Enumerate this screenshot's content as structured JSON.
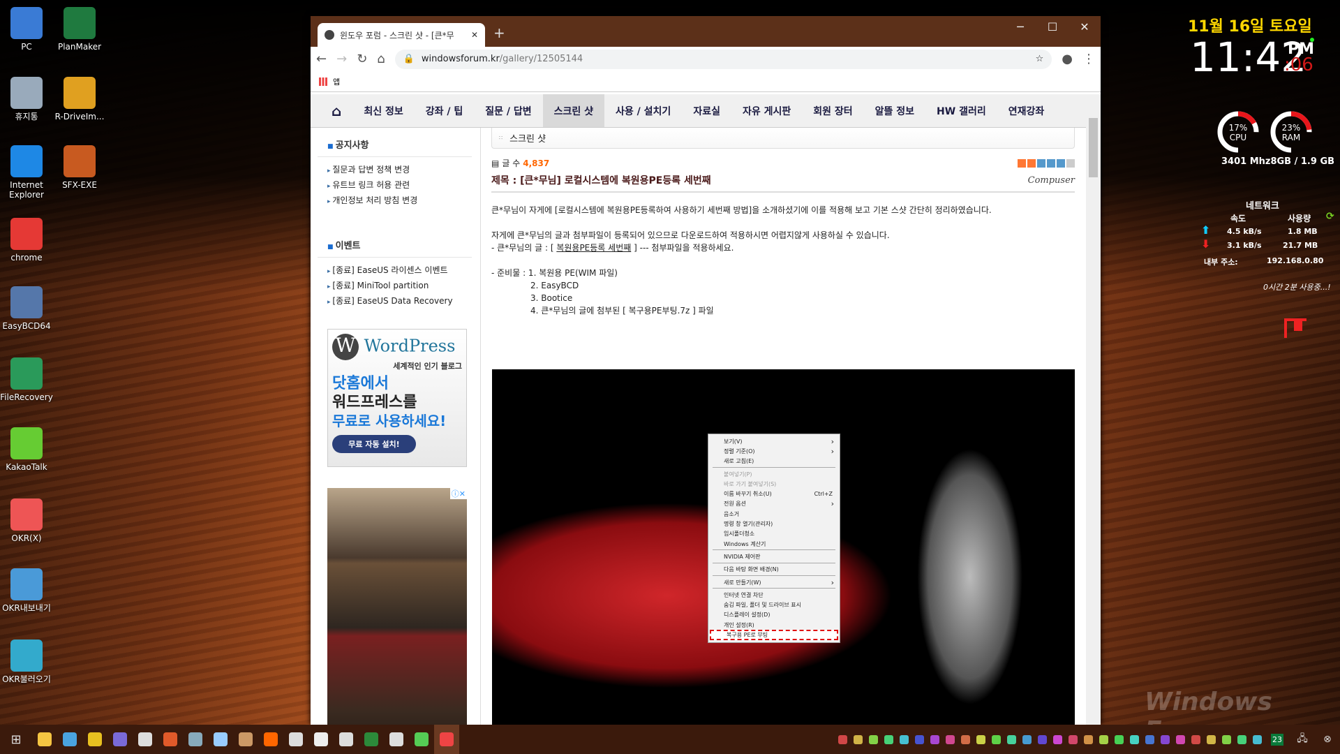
{
  "desktop": {
    "icons": [
      "PC",
      "PlanMaker",
      "휴지통",
      "R-DriveIm...",
      "Internet Explorer",
      "SFX-EXE",
      "chrome",
      "EasyBCD64",
      "FileRecovery",
      "KakaoTalk",
      "OKR(X)",
      "OKR내보내기",
      "OKR불러오기"
    ]
  },
  "browser": {
    "tab_title": "윈도우 포럼 - 스크린 샷 - [큰*무",
    "url_host": "windowsforum.kr",
    "url_path": "/gallery/12505144",
    "bookmark_apps": "앱"
  },
  "site": {
    "nav": [
      "최신 정보",
      "강좌 / 팁",
      "질문 / 답변",
      "스크린 샷",
      "사용 / 설치기",
      "자료실",
      "자유 게시판",
      "회원 장터",
      "알뜰 정보",
      "HW 갤러리",
      "연재강좌"
    ],
    "sidebar": {
      "notice_title": "공지사항",
      "notices": [
        "질문과 답변 정책 변경",
        "유트브 링크 허용 관련",
        "개인정보 처리 방침 변경"
      ],
      "event_title": "이벤트",
      "events": [
        "[종료] EaseUS 라이센스 이벤트",
        "[종료] MiniTool partition",
        "[종료] EaseUS Data Recovery"
      ],
      "ad": {
        "brand": "WordPress",
        "tagline": "세계적인 인기 블로그",
        "line1": "닷홈에서",
        "line2": "워드프레스를",
        "line3": "무료로 사용하세요!",
        "button": "무료 자동 설치!"
      }
    },
    "breadcrumb": "스크린 샷",
    "count_label": "글 수",
    "count": "4,837",
    "title": "제목 : [큰*무님] 로컬시스템에 복원용PE등록 세번째",
    "author": "Compuser",
    "body": {
      "p1": "큰*무님이 자게에 [로컬시스템에 복원용PE등록하여 사용하기 세번째 방법]을 소개하셨기에 이를 적용해 보고 기본 스샷 간단히 정리하였습니다.",
      "p2": "자게에 큰*무님의 글과 첨부파일이 등록되어 있으므로 다운로드하여 적용하시면 어렵지않게 사용하실 수 있습니다.",
      "p3_pre": "- 큰*무님의 글 : [ ",
      "p3_link": "복원용PE등록 세번째",
      "p3_post": " ]  --- 첨부파일을 적용하세요.",
      "prep": [
        "- 준비물 : 1. 복원용 PE(WIM 파일)",
        "2. EasyBCD",
        "3. Bootice",
        "4. 큰*무님의 글에 첨부된 [ 복구용PE부팅.7z ] 파일"
      ]
    },
    "watermark": "Windows Forum"
  },
  "context_menu": [
    {
      "label": "보기(V)",
      "arrow": true
    },
    {
      "label": "정렬 기준(O)",
      "arrow": true
    },
    {
      "label": "새로 고침(E)"
    },
    {
      "sep": true
    },
    {
      "label": "붙여넣기(P)",
      "disabled": true
    },
    {
      "label": "바로 가기 붙여넣기(S)",
      "disabled": true
    },
    {
      "label": "이름 바꾸기 취소(U)",
      "shortcut": "Ctrl+Z"
    },
    {
      "label": "전원 옵션",
      "arrow": true
    },
    {
      "label": "음소거"
    },
    {
      "label": "명령 창 열기(관리자)"
    },
    {
      "label": "임시폴더청소"
    },
    {
      "label": "Windows 계산기"
    },
    {
      "sep": true
    },
    {
      "label": "NVIDIA 제어판"
    },
    {
      "sep": true
    },
    {
      "label": "다음 바탕 화면 배경(N)"
    },
    {
      "sep": true
    },
    {
      "label": "새로 만들기(W)",
      "arrow": true
    },
    {
      "sep": true
    },
    {
      "label": "인터넷 연결 차단"
    },
    {
      "label": "숨김 파일, 폴더 및 드라이브 표시"
    },
    {
      "label": "디스플레이 설정(D)"
    },
    {
      "label": "개인 설정(R)"
    },
    {
      "label": "복구용 PE로 부팅",
      "highlight": true
    }
  ],
  "widget": {
    "date": "11월 16일 토요일",
    "time": "11:42",
    "ampm": "PM",
    "seconds": ":06",
    "cpu_pct": 17,
    "cpu_label": "17%",
    "cpu": "CPU",
    "ram_pct": 23,
    "ram_label": "23%",
    "ram": "RAM",
    "sys": "3401 Mhz8GB /  1.9 GB",
    "net_title": "네트워크",
    "speed": "속도",
    "usage": "사용량",
    "up_speed": "4.5 kB/s",
    "up_usage": "1.8 MB",
    "down_speed": "3.1 kB/s",
    "down_usage": "21.7 MB",
    "ip_label": "내부 주소:",
    "ip": "192.168.0.80",
    "uptime": "0시간 2분 사용중...!"
  },
  "tray": {
    "date_badge": "23"
  },
  "colors": {
    "accent_red": "#e8161b",
    "titlebar": "#5c3019",
    "count": "#ff6600",
    "date": "#ffd700"
  }
}
